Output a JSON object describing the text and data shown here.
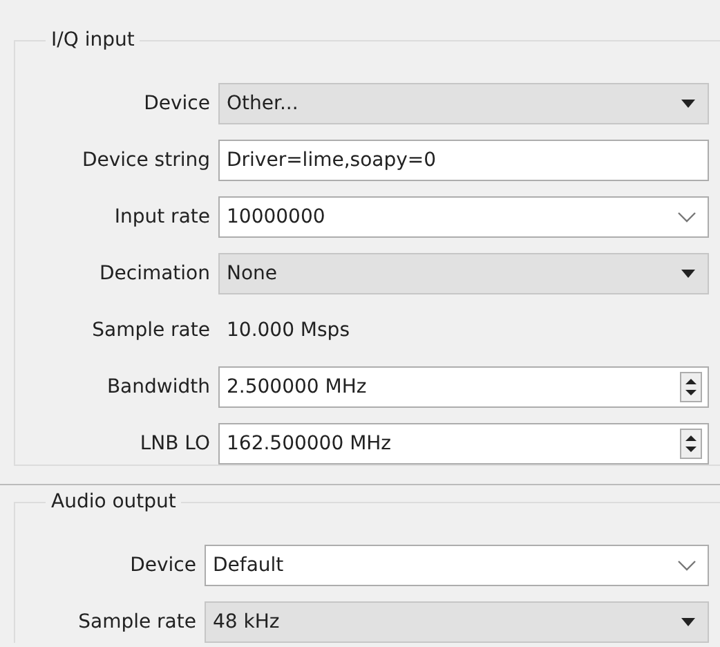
{
  "groups": [
    {
      "title": "I/Q input",
      "rows": [
        {
          "label": "Device",
          "kind": "combo",
          "value": "Other..."
        },
        {
          "label": "Device string",
          "kind": "text",
          "value": "Driver=lime,soapy=0"
        },
        {
          "label": "Input rate",
          "kind": "editable-combo",
          "value": "10000000"
        },
        {
          "label": "Decimation",
          "kind": "combo",
          "value": "None"
        },
        {
          "label": "Sample rate",
          "kind": "readout",
          "value": "10.000 Msps"
        },
        {
          "label": "Bandwidth",
          "kind": "spin",
          "value": "2.500000 MHz"
        },
        {
          "label": "LNB LO",
          "kind": "spin",
          "value": "162.500000 MHz"
        }
      ]
    },
    {
      "title": "Audio output",
      "rows": [
        {
          "label": "Device",
          "kind": "editable-combo",
          "value": "Default"
        },
        {
          "label": "Sample rate",
          "kind": "combo",
          "value": "48 kHz"
        }
      ]
    }
  ]
}
